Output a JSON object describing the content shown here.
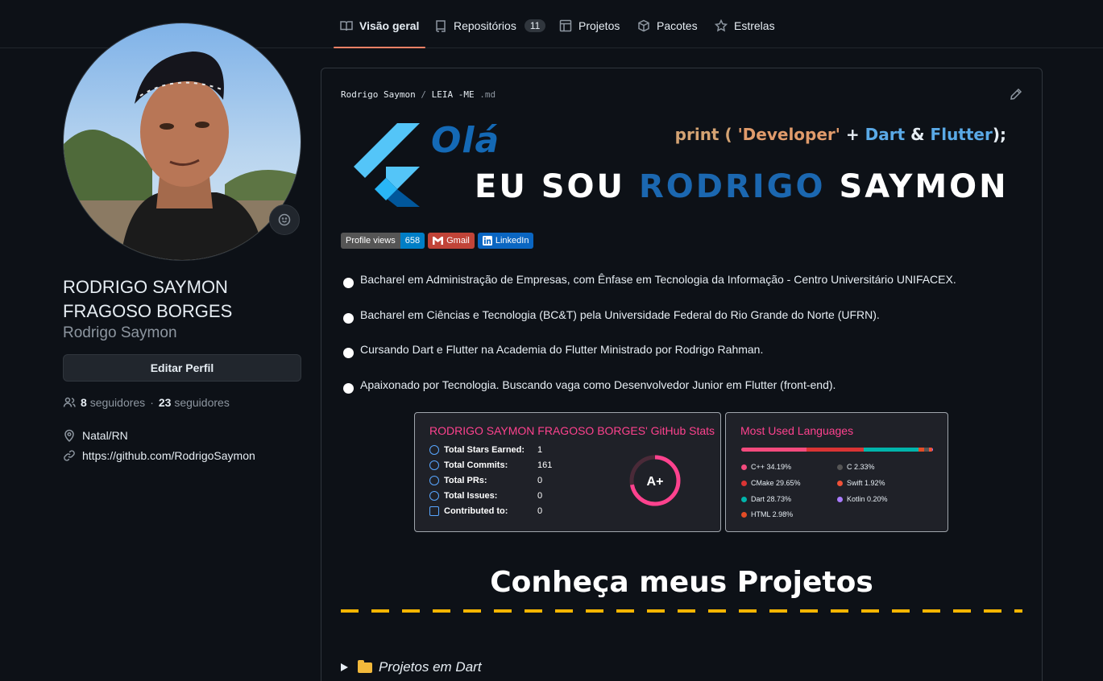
{
  "nav": {
    "tabs": [
      {
        "label": "Visão geral",
        "icon": "book-icon",
        "active": true
      },
      {
        "label": "Repositórios",
        "icon": "repo-icon",
        "count": "11"
      },
      {
        "label": "Projetos",
        "icon": "table-icon"
      },
      {
        "label": "Pacotes",
        "icon": "package-icon"
      },
      {
        "label": "Estrelas",
        "icon": "star-icon"
      }
    ]
  },
  "profile": {
    "full_name": "RODRIGO SAYMON FRAGOSO BORGES",
    "login": "Rodrigo Saymon",
    "edit_label": "Editar Perfil",
    "followers_count": "8",
    "followers_label": "seguidores",
    "separator": "·",
    "following_count": "23",
    "following_label": "seguidores",
    "location": "Natal/RN",
    "website": "https://github.com/RodrigoSaymon"
  },
  "readme": {
    "crumb_user": "Rodrigo Saymon",
    "crumb_sep": "/",
    "crumb_file": "LEIA -ME",
    "crumb_ext": ".md",
    "banner": {
      "greeting": "Olá",
      "print_kw": "print (",
      "print_str": "'Developer'",
      "print_plus": "+",
      "print_dart": "Dart",
      "print_amp": "&",
      "print_flutter": "Flutter",
      "print_end": ");",
      "eu_sou": "EU SOU",
      "name_first": "RODRIGO",
      "name_last": "SAYMON"
    },
    "badges": [
      {
        "left": "Profile views",
        "right": "658",
        "left_color": "#555555",
        "right_color": "#007ec6"
      },
      {
        "left": "Gmail",
        "color": "#c14438"
      },
      {
        "left": "LinkedIn",
        "color": "#0a66c2"
      }
    ],
    "bullets": [
      "Bacharel em Administração de Empresas, com Ênfase em Tecnologia da Informação - Centro Universitário UNIFACEX.",
      "Bacharel em Ciências e Tecnologia (BC&T) pela Universidade Federal do Rio Grande do Norte (UFRN).",
      "Cursando Dart e Flutter na Academia do Flutter Ministrado por Rodrigo Rahman.",
      "Apaixonado por Tecnologia. Buscando vaga como Desenvolvedor Junior em Flutter (front-end)."
    ],
    "stats_card": {
      "title": "RODRIGO SAYMON FRAGOSO BORGES' GitHub Stats",
      "rows": [
        {
          "label": "Total Stars Earned:",
          "value": "1",
          "icon": "star-icon"
        },
        {
          "label": "Total Commits:",
          "value": "161",
          "icon": "history-icon"
        },
        {
          "label": "Total PRs:",
          "value": "0",
          "icon": "pull-request-icon"
        },
        {
          "label": "Total Issues:",
          "value": "0",
          "icon": "issue-icon"
        },
        {
          "label": "Contributed to:",
          "value": "0",
          "icon": "repo-icon"
        }
      ],
      "rank": "A+",
      "rank_progress": 0.72
    },
    "langs_card": {
      "title": "Most Used Languages",
      "languages": [
        {
          "name": "C++",
          "percent": 34.19,
          "label": "C++ 34.19%",
          "color": "#f34b7d"
        },
        {
          "name": "CMake",
          "percent": 29.65,
          "label": "CMake 29.65%",
          "color": "#DA3434"
        },
        {
          "name": "Dart",
          "percent": 28.73,
          "label": "Dart 28.73%",
          "color": "#00B4AB"
        },
        {
          "name": "HTML",
          "percent": 2.98,
          "label": "HTML 2.98%",
          "color": "#e34c26"
        },
        {
          "name": "C",
          "percent": 2.33,
          "label": "C 2.33%",
          "color": "#555555"
        },
        {
          "name": "Swift",
          "percent": 1.92,
          "label": "Swift 1.92%",
          "color": "#F05138"
        },
        {
          "name": "Kotlin",
          "percent": 0.2,
          "label": "Kotlin 0.20%",
          "color": "#A97BFF"
        }
      ]
    },
    "projects_title": "Conheça meus Projetos",
    "summary_label": "Projetos em Dart"
  }
}
